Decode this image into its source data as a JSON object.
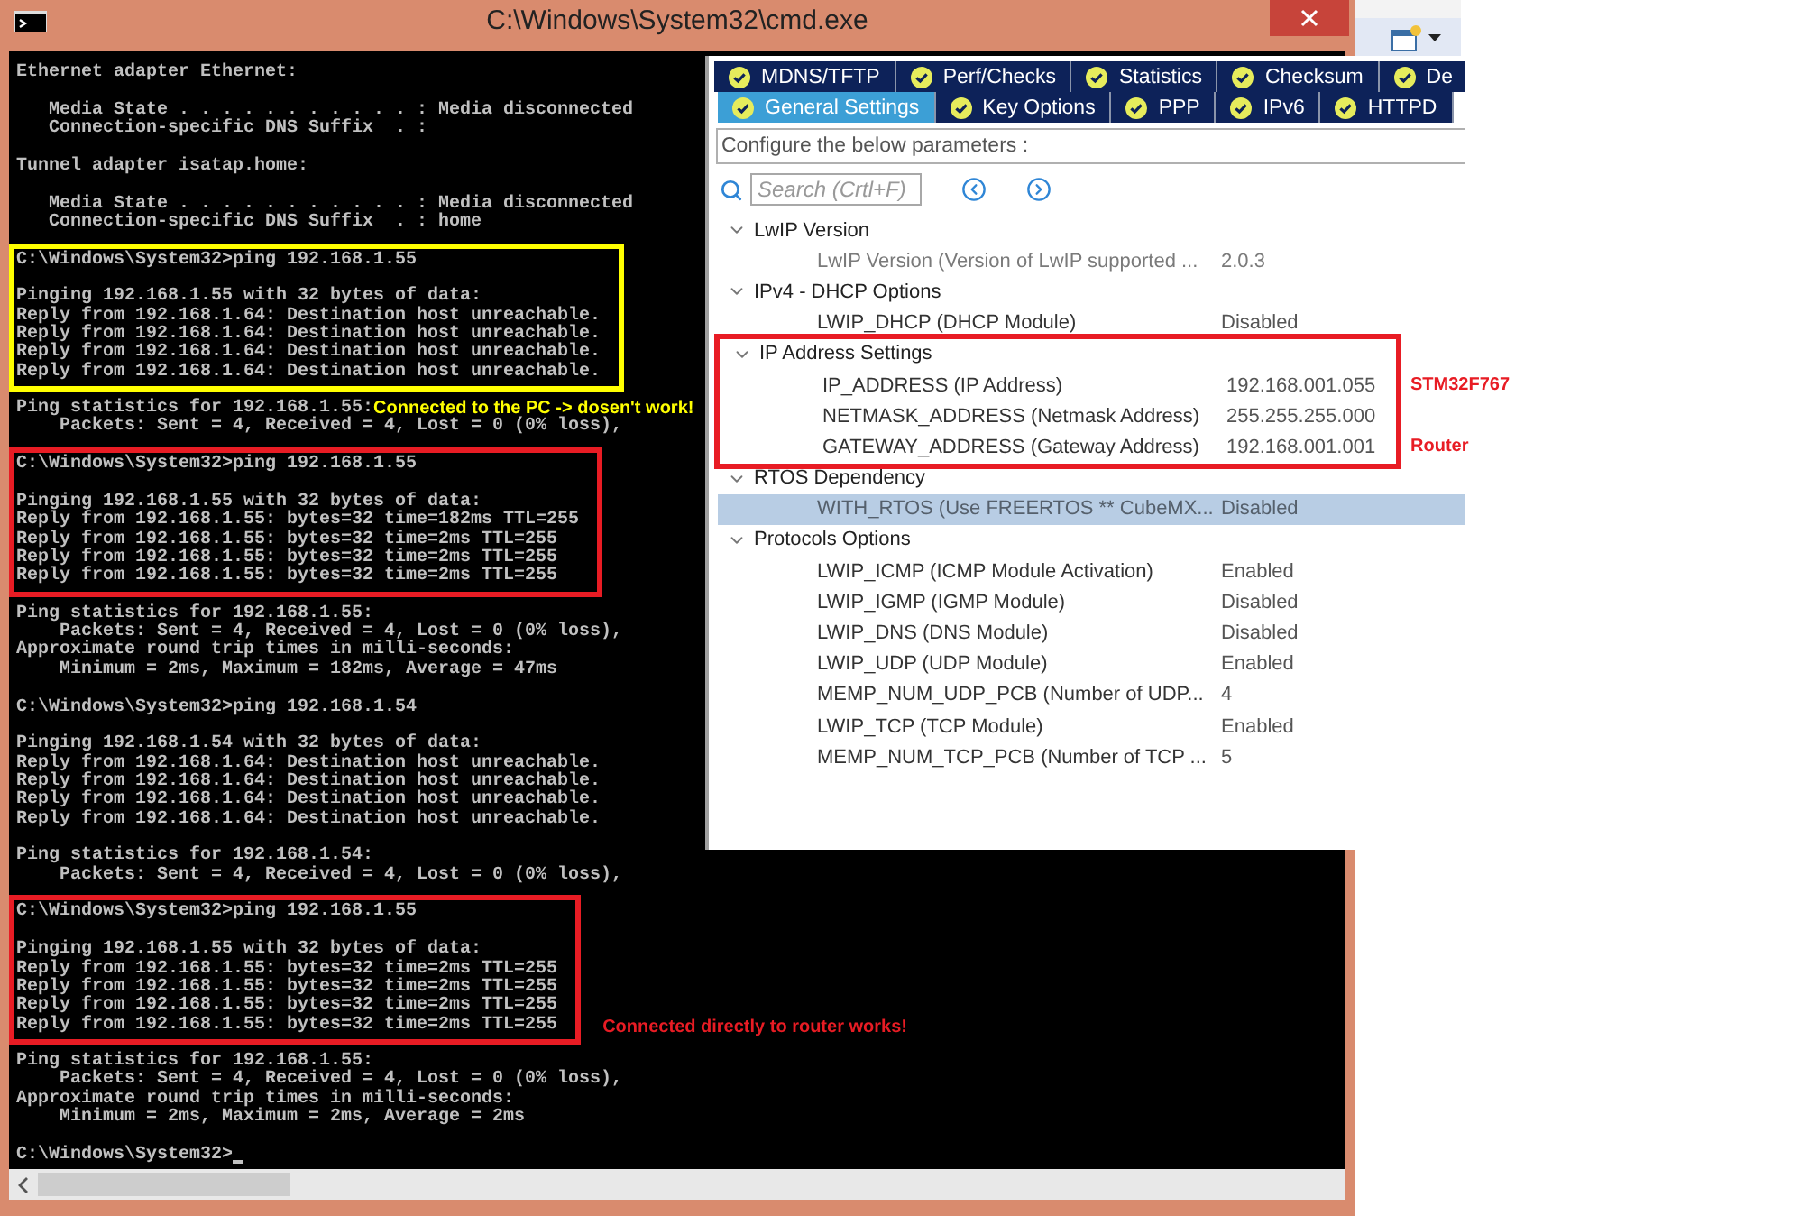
{
  "console_window": {
    "title": "C:\\Windows\\System32\\cmd.exe",
    "sections": [
      {
        "paragraphs": [
          [
            "Ethernet adapter Ethernet:"
          ],
          [
            "   Media State . . . . . . . . . . . : Media disconnected",
            "   Connection-specific DNS Suffix  . :"
          ],
          [
            "Tunnel adapter isatap.home:"
          ],
          [
            "   Media State . . . . . . . . . . . : Media disconnected",
            "   Connection-specific DNS Suffix  . : home"
          ]
        ]
      },
      {
        "color": "#ffff00",
        "paragraphs": [
          [
            "C:\\Windows\\System32>ping 192.168.1.55"
          ],
          [
            "Pinging 192.168.1.55 with 32 bytes of data:",
            "Reply from 192.168.1.64: Destination host unreachable.",
            "Reply from 192.168.1.64: Destination host unreachable.",
            "Reply from 192.168.1.64: Destination host unreachable.",
            "Reply from 192.168.1.64: Destination host unreachable."
          ]
        ]
      },
      {
        "inline_note": "Connected to the PC -> dosen't work!",
        "paragraphs": [
          [
            "Ping statistics for 192.168.1.55:",
            "    Packets: Sent = 4, Received = 4, Lost = 0 (0% loss),"
          ]
        ]
      },
      {
        "color": "#e81c24",
        "paragraphs": [
          [
            "C:\\Windows\\System32>ping 192.168.1.55"
          ],
          [
            "Pinging 192.168.1.55 with 32 bytes of data:",
            "Reply from 192.168.1.55: bytes=32 time=182ms TTL=255",
            "Reply from 192.168.1.55: bytes=32 time=2ms TTL=255",
            "Reply from 192.168.1.55: bytes=32 time=2ms TTL=255",
            "Reply from 192.168.1.55: bytes=32 time=2ms TTL=255"
          ]
        ]
      },
      {
        "paragraphs": [
          [
            "Ping statistics for 192.168.1.55:",
            "    Packets: Sent = 4, Received = 4, Lost = 0 (0% loss),",
            "Approximate round trip times in milli-seconds:",
            "    Minimum = 2ms, Maximum = 182ms, Average = 47ms"
          ],
          [
            "C:\\Windows\\System32>ping 192.168.1.54"
          ],
          [
            "Pinging 192.168.1.54 with 32 bytes of data:",
            "Reply from 192.168.1.64: Destination host unreachable.",
            "Reply from 192.168.1.64: Destination host unreachable.",
            "Reply from 192.168.1.64: Destination host unreachable.",
            "Reply from 192.168.1.64: Destination host unreachable."
          ],
          [
            "Ping statistics for 192.168.1.54:",
            "    Packets: Sent = 4, Received = 4, Lost = 0 (0% loss),"
          ]
        ]
      },
      {
        "color": "#e81c24",
        "side_note": "Connected directly to router works!",
        "paragraphs": [
          [
            "C:\\Windows\\System32>ping 192.168.1.55"
          ],
          [
            "Pinging 192.168.1.55 with 32 bytes of data:",
            "Reply from 192.168.1.55: bytes=32 time=2ms TTL=255",
            "Reply from 192.168.1.55: bytes=32 time=2ms TTL=255",
            "Reply from 192.168.1.55: bytes=32 time=2ms TTL=255",
            "Reply from 192.168.1.55: bytes=32 time=2ms TTL=255"
          ]
        ]
      },
      {
        "paragraphs": [
          [
            "Ping statistics for 192.168.1.55:",
            "    Packets: Sent = 4, Received = 4, Lost = 0 (0% loss),",
            "Approximate round trip times in milli-seconds:",
            "    Minimum = 2ms, Maximum = 2ms, Average = 2ms"
          ],
          [
            "C:\\Windows\\System32>"
          ]
        ]
      }
    ]
  },
  "config_panel": {
    "tab_rows": [
      [
        {
          "label": "MDNS/TFTP",
          "selected": false
        },
        {
          "label": "Perf/Checks",
          "selected": false
        },
        {
          "label": "Statistics",
          "selected": false
        },
        {
          "label": "Checksum",
          "selected": false
        },
        {
          "label": "De",
          "selected": false
        }
      ],
      [
        {
          "label": "General Settings",
          "selected": true
        },
        {
          "label": "Key Options",
          "selected": false
        },
        {
          "label": "PPP",
          "selected": false
        },
        {
          "label": "IPv6",
          "selected": false
        },
        {
          "label": "HTTPD",
          "selected": false
        }
      ]
    ],
    "heading": "Configure the below parameters :",
    "search": {
      "placeholder": "Search (Crtl+F)"
    },
    "tree": [
      {
        "label": "LwIP Version",
        "expanded": true,
        "items": [
          {
            "label": "LwIP Version (Version of LwIP supported ...",
            "value": "2.0.3",
            "disabled": true,
            "selected": false
          }
        ]
      },
      {
        "label": "IPv4 - DHCP Options",
        "expanded": true,
        "items": [
          {
            "label": "LWIP_DHCP (DHCP Module)",
            "value": "Disabled",
            "disabled": false,
            "selected": false
          }
        ]
      },
      {
        "label": "IP Address Settings",
        "expanded": true,
        "color": "#e81c24",
        "items": [
          {
            "label": "IP_ADDRESS (IP Address)",
            "value": "192.168.001.055",
            "disabled": false,
            "selected": false,
            "note": "STM32F767"
          },
          {
            "label": "NETMASK_ADDRESS (Netmask Address)",
            "value": "255.255.255.000",
            "disabled": false,
            "selected": false
          },
          {
            "label": "GATEWAY_ADDRESS (Gateway Address)",
            "value": "192.168.001.001",
            "disabled": false,
            "selected": false,
            "note": "Router"
          }
        ]
      },
      {
        "label": "RTOS Dependency",
        "expanded": true,
        "items": [
          {
            "label": "WITH_RTOS (Use FREERTOS ** CubeMX...",
            "value": "Disabled",
            "disabled": true,
            "selected": true
          }
        ]
      },
      {
        "label": "Protocols Options",
        "expanded": true,
        "items": [
          {
            "label": "LWIP_ICMP (ICMP Module Activation)",
            "value": "Enabled",
            "disabled": false,
            "selected": false
          },
          {
            "label": "LWIP_IGMP (IGMP Module)",
            "value": "Disabled",
            "disabled": false,
            "selected": false
          },
          {
            "label": "LWIP_DNS (DNS Module)",
            "value": "Disabled",
            "disabled": false,
            "selected": false
          },
          {
            "label": "LWIP_UDP (UDP Module)",
            "value": "Enabled",
            "disabled": false,
            "selected": false
          },
          {
            "label": "MEMP_NUM_UDP_PCB (Number of UDP...",
            "value": "4",
            "disabled": false,
            "selected": false
          },
          {
            "label": "LWIP_TCP (TCP Module)",
            "value": "Enabled",
            "disabled": false,
            "selected": false
          },
          {
            "label": "MEMP_NUM_TCP_PCB (Number of TCP ...",
            "value": "5",
            "disabled": false,
            "selected": false
          }
        ]
      }
    ]
  }
}
